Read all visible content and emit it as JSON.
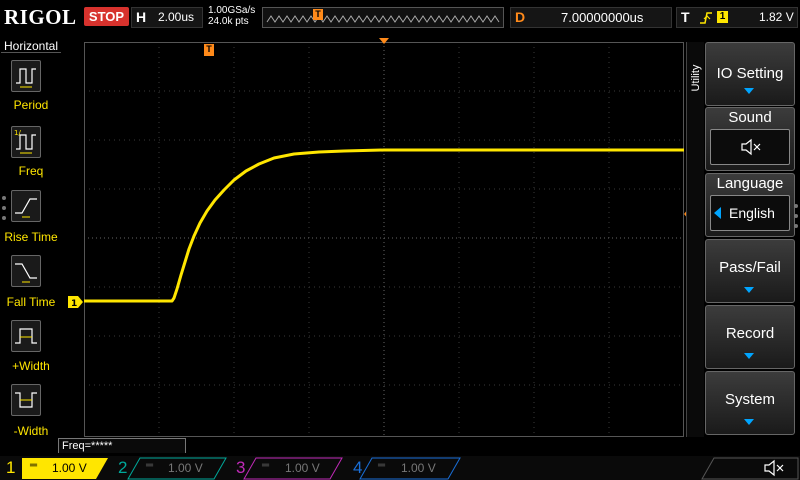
{
  "top": {
    "logo": "RIGOL",
    "run_status": "STOP",
    "timebase_letter": "H",
    "timebase_value": "2.00us",
    "sample_rate": "1.00GSa/s",
    "memory_depth": "24.0k pts",
    "trigger_position_letter": "D",
    "trigger_position_value": "7.00000000us",
    "trigger_letter": "T",
    "trigger_source": "1",
    "trigger_level": "1.82 V"
  },
  "left_panel": {
    "title": "Horizontal",
    "items": [
      {
        "label": "Period",
        "icon": "period-icon"
      },
      {
        "label": "Freq",
        "icon": "freq-icon"
      },
      {
        "label": "Rise Time",
        "icon": "rise-time-icon"
      },
      {
        "label": "Fall Time",
        "icon": "fall-time-icon"
      },
      {
        "label": "+Width",
        "icon": "positive-width-icon"
      },
      {
        "label": "-Width",
        "icon": "negative-width-icon"
      }
    ]
  },
  "right_menu": {
    "tab_label": "Utility",
    "items": [
      {
        "label": "IO Setting"
      },
      {
        "label": "Sound",
        "sub_icon": "speaker-muted-icon"
      },
      {
        "label": "Language",
        "value": "English"
      },
      {
        "label": "Pass/Fail"
      },
      {
        "label": "Record"
      },
      {
        "label": "System"
      }
    ]
  },
  "markers": {
    "trigger_pos": "T",
    "channel1": "1"
  },
  "freq_counter": "Freq=*****",
  "channels": [
    {
      "number": "1",
      "scale": "1.00 V",
      "color": "#ffe600",
      "active": true
    },
    {
      "number": "2",
      "scale": "1.00 V",
      "color": "#00a89a",
      "active": false
    },
    {
      "number": "3",
      "scale": "1.00 V",
      "color": "#c02ab8",
      "active": false
    },
    {
      "number": "4",
      "scale": "1.00 V",
      "color": "#1a6fd8",
      "active": false
    }
  ],
  "colors": {
    "trace": "#ffe600",
    "stop": "#d7322d",
    "trigger_marker": "#ff8a1a",
    "menu_arrow": "#00a5ff"
  }
}
